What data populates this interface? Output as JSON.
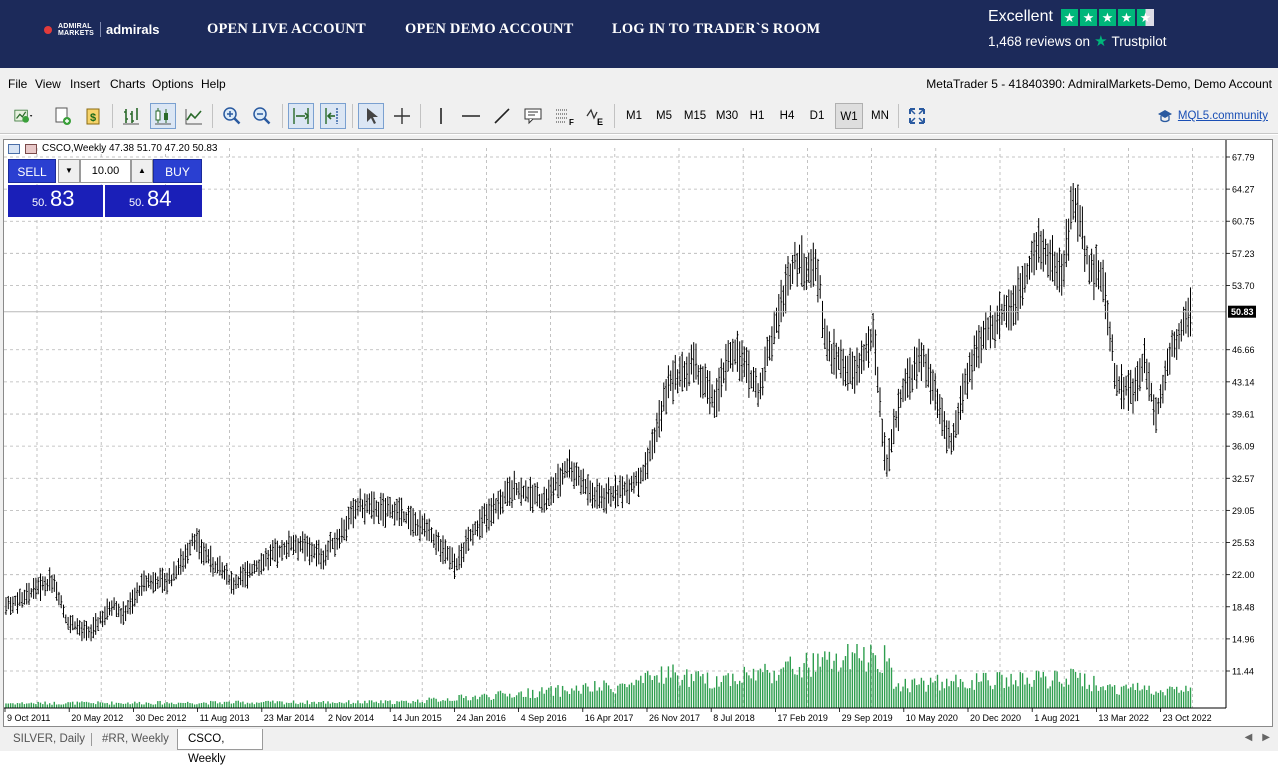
{
  "banner": {
    "logo_small_1": "ADMIRAL",
    "logo_small_2": "MARKETS",
    "logo_brand": "admirals",
    "links": [
      "OPEN LIVE ACCOUNT",
      "OPEN DEMO ACCOUNT",
      "LOG IN TO TRADER`S ROOM"
    ],
    "trustpilot": {
      "rating_word": "Excellent",
      "reviews": "1,468 reviews on",
      "brand": "Trustpilot",
      "stars": 4.5
    }
  },
  "menu": {
    "items": [
      "File",
      "View",
      "Insert",
      "Charts",
      "Options",
      "Help"
    ],
    "account": "MetaTrader 5 - 41840390: AdmiralMarkets-Demo, Demo Account"
  },
  "toolbar": {
    "timeframes": [
      "M1",
      "M5",
      "M15",
      "M30",
      "H1",
      "H4",
      "D1",
      "W1",
      "MN"
    ],
    "active_timeframe": "W1",
    "community_link": "MQL5.community"
  },
  "chart": {
    "header": "CSCO,Weekly  47.38 51.70 47.20 50.83",
    "one_click": {
      "sell_label": "SELL",
      "buy_label": "BUY",
      "volume": "10.00",
      "sell_price_small": "50.",
      "sell_price_big": "83",
      "buy_price_small": "50.",
      "buy_price_big": "84"
    },
    "current_price_label": "50.83"
  },
  "chart_data": {
    "type": "bar",
    "symbol": "CSCO",
    "period": "Weekly",
    "ohlc_last": {
      "open": 47.38,
      "high": 51.7,
      "low": 47.2,
      "close": 50.83
    },
    "y_ticks": [
      "67.79",
      "64.27",
      "60.75",
      "57.23",
      "53.70",
      "50.83",
      "46.66",
      "43.14",
      "39.61",
      "36.09",
      "32.57",
      "29.05",
      "25.53",
      "22.00",
      "18.48",
      "14.96",
      "11.44"
    ],
    "x_ticks": [
      "9 Oct 2011",
      "20 May 2012",
      "30 Dec 2012",
      "11 Aug 2013",
      "23 Mar 2014",
      "2 Nov 2014",
      "14 Jun 2015",
      "24 Jan 2016",
      "4 Sep 2016",
      "16 Apr 2017",
      "26 Nov 2017",
      "8 Jul 2018",
      "17 Feb 2019",
      "29 Sep 2019",
      "10 May 2020",
      "20 Dec 2020",
      "1 Aug 2021",
      "13 Mar 2022",
      "23 Oct 2022"
    ],
    "ylim": [
      11.44,
      67.79
    ],
    "price_path": [
      [
        0,
        18.5
      ],
      [
        20,
        19.5
      ],
      [
        50,
        21.5
      ],
      [
        62,
        17.0
      ],
      [
        85,
        15.5
      ],
      [
        110,
        19.0
      ],
      [
        118,
        17.5
      ],
      [
        140,
        21.0
      ],
      [
        168,
        21.5
      ],
      [
        190,
        26.0
      ],
      [
        210,
        23.0
      ],
      [
        230,
        21.0
      ],
      [
        260,
        23.5
      ],
      [
        290,
        25.5
      ],
      [
        320,
        24.0
      ],
      [
        355,
        29.5
      ],
      [
        390,
        29.0
      ],
      [
        420,
        27.0
      ],
      [
        452,
        23.0
      ],
      [
        470,
        27.0
      ],
      [
        510,
        31.5
      ],
      [
        540,
        30.0
      ],
      [
        565,
        34.0
      ],
      [
        590,
        30.5
      ],
      [
        615,
        31.0
      ],
      [
        640,
        33.0
      ],
      [
        665,
        43.0
      ],
      [
        690,
        45.0
      ],
      [
        710,
        41.0
      ],
      [
        730,
        47.0
      ],
      [
        755,
        42.0
      ],
      [
        770,
        49.0
      ],
      [
        790,
        56.5
      ],
      [
        815,
        55.0
      ],
      [
        822,
        47.0
      ],
      [
        850,
        44.0
      ],
      [
        870,
        48.0
      ],
      [
        882,
        34.0
      ],
      [
        900,
        43.0
      ],
      [
        920,
        46.0
      ],
      [
        935,
        40.0
      ],
      [
        948,
        36.0
      ],
      [
        960,
        43.0
      ],
      [
        985,
        49.0
      ],
      [
        1010,
        52.0
      ],
      [
        1035,
        58.0
      ],
      [
        1058,
        55.0
      ],
      [
        1070,
        63.5
      ],
      [
        1085,
        56.0
      ],
      [
        1100,
        54.0
      ],
      [
        1112,
        43.0
      ],
      [
        1130,
        42.0
      ],
      [
        1140,
        46.0
      ],
      [
        1152,
        39.5
      ],
      [
        1168,
        47.0
      ],
      [
        1188,
        50.83
      ]
    ],
    "volume_bands": [
      [
        0,
        0.08
      ],
      [
        400,
        0.1
      ],
      [
        565,
        0.3
      ],
      [
        636,
        0.4
      ],
      [
        660,
        0.6
      ],
      [
        700,
        0.45
      ],
      [
        880,
        0.9
      ],
      [
        890,
        0.4
      ],
      [
        1075,
        0.5
      ],
      [
        1100,
        0.35
      ],
      [
        1188,
        0.3
      ]
    ]
  },
  "tabs": [
    "SILVER, Daily",
    "#RR, Weekly",
    "CSCO, Weekly"
  ],
  "active_tab": "CSCO, Weekly",
  "colors": {
    "banner": "#1c2a5a",
    "trustpilot": "#00b67a",
    "buy_sell": "#1a1fb8",
    "volume": "#2e9e4e"
  }
}
